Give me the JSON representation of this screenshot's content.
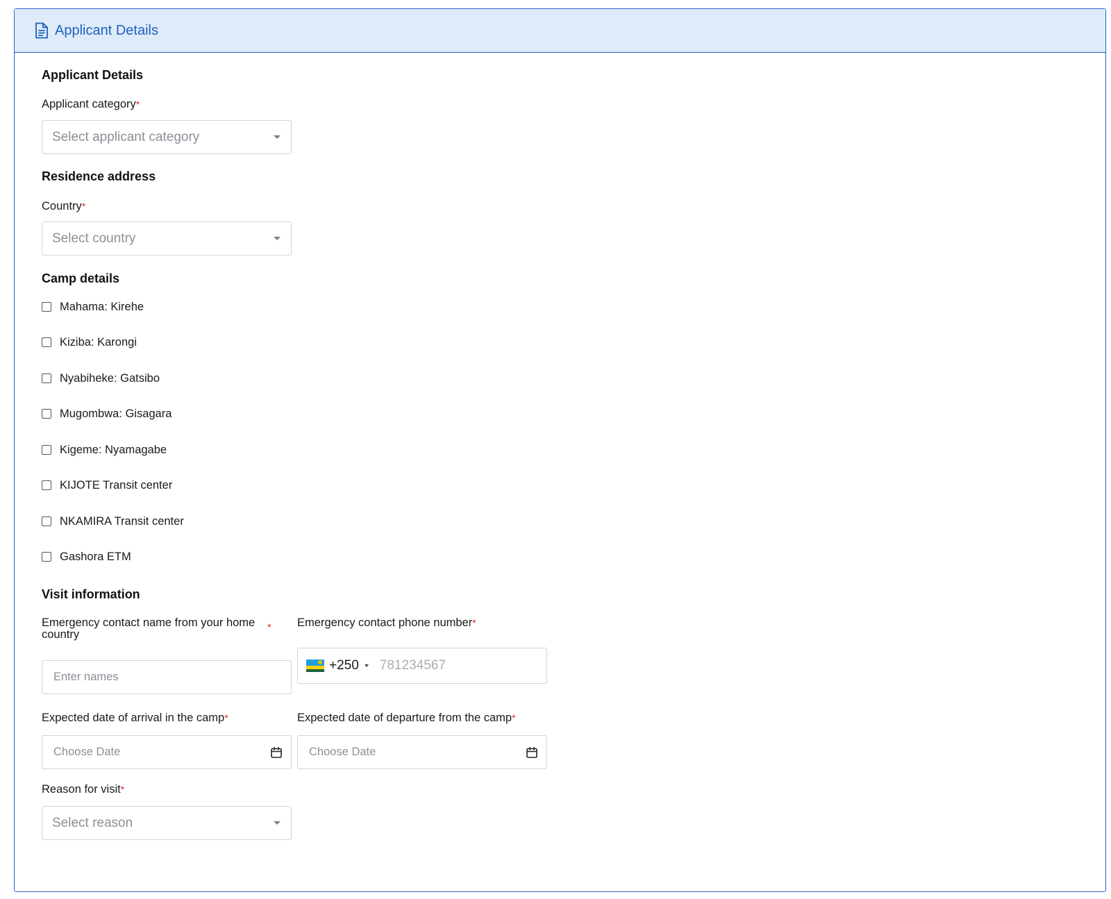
{
  "header": {
    "title": "Applicant Details",
    "icon": "document-icon",
    "accent_color": "#2b63c6",
    "background_color": "#deebf8"
  },
  "sections": {
    "applicant": {
      "title": "Applicant Details",
      "category_label": "Applicant category",
      "category_placeholder": "Select applicant category"
    },
    "residence": {
      "title": "Residence address",
      "country_label": "Country",
      "country_placeholder": "Select country"
    },
    "camp": {
      "title": "Camp details",
      "options": [
        "Mahama: Kirehe",
        "Kiziba: Karongi",
        "Nyabiheke: Gatsibo",
        "Mugombwa: Gisagara",
        "Kigeme: Nyamagabe",
        "KIJOTE Transit center",
        "NKAMIRA Transit center",
        "Gashora ETM"
      ]
    },
    "visit": {
      "title": "Visit information",
      "emergency_name_label_line1": "Emergency contact name from your home",
      "emergency_name_label_line2": "country",
      "emergency_name_placeholder": "Enter names",
      "emergency_phone_label": "Emergency contact phone number",
      "phone_dial_code": "+250",
      "phone_placeholder": "781234567",
      "arrival_label": "Expected date of arrival in the camp",
      "arrival_placeholder": "Choose Date",
      "departure_label": "Expected date of departure from the camp",
      "departure_placeholder": "Choose Date",
      "reason_label": "Reason for visit",
      "reason_placeholder": "Select reason"
    }
  },
  "required_marker": "*"
}
